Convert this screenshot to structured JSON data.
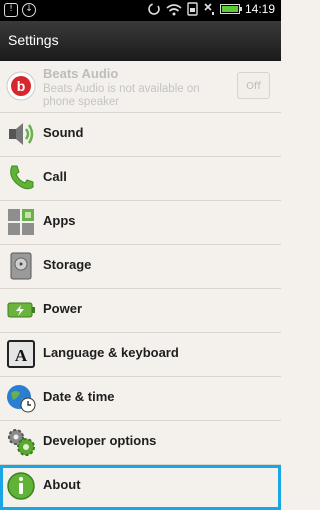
{
  "status_bar": {
    "time": "14:19"
  },
  "title_bar": {
    "title": "Settings"
  },
  "beats": {
    "label": "Beats Audio",
    "subtitle": "Beats Audio is not available on phone speaker",
    "toggle": "Off"
  },
  "items": [
    {
      "label": "Sound"
    },
    {
      "label": "Call"
    },
    {
      "label": "Apps"
    },
    {
      "label": "Storage"
    },
    {
      "label": "Power"
    },
    {
      "label": "Language & keyboard"
    },
    {
      "label": "Date & time"
    },
    {
      "label": "Developer options"
    },
    {
      "label": "About"
    }
  ],
  "colors": {
    "highlight": "#1aa6e4",
    "background": "#f4f1ec",
    "title_bar": "#2a2a2a"
  }
}
